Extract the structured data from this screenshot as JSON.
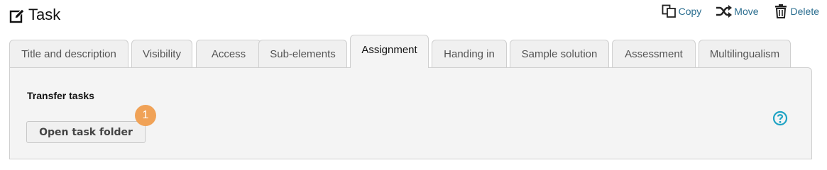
{
  "header": {
    "title": "Task"
  },
  "actions": {
    "copy": "Copy",
    "move": "Move",
    "delete": "Delete"
  },
  "tabs": [
    {
      "label": "Title and description",
      "active": false
    },
    {
      "label": "Visibility",
      "active": false
    },
    {
      "label": "Access",
      "active": false
    },
    {
      "label": "Sub-elements",
      "active": false
    },
    {
      "label": "Assignment",
      "active": true
    },
    {
      "label": "Handing in",
      "active": false
    },
    {
      "label": "Sample solution",
      "active": false
    },
    {
      "label": "Assessment",
      "active": false
    },
    {
      "label": "Multilingualism",
      "active": false
    }
  ],
  "panel": {
    "section_title": "Transfer tasks",
    "open_button": "Open task folder",
    "badge": "1"
  },
  "colors": {
    "accent": "#2a6d8f",
    "badge": "#f0a257",
    "help": "#1fa3c4",
    "panel_bg": "#f4f4f4",
    "tab_bg": "#f0f0f0"
  },
  "icons": {
    "title": "edit-icon",
    "copy": "copy-icon",
    "move": "shuffle-icon",
    "delete": "trash-icon",
    "help": "help-icon"
  }
}
